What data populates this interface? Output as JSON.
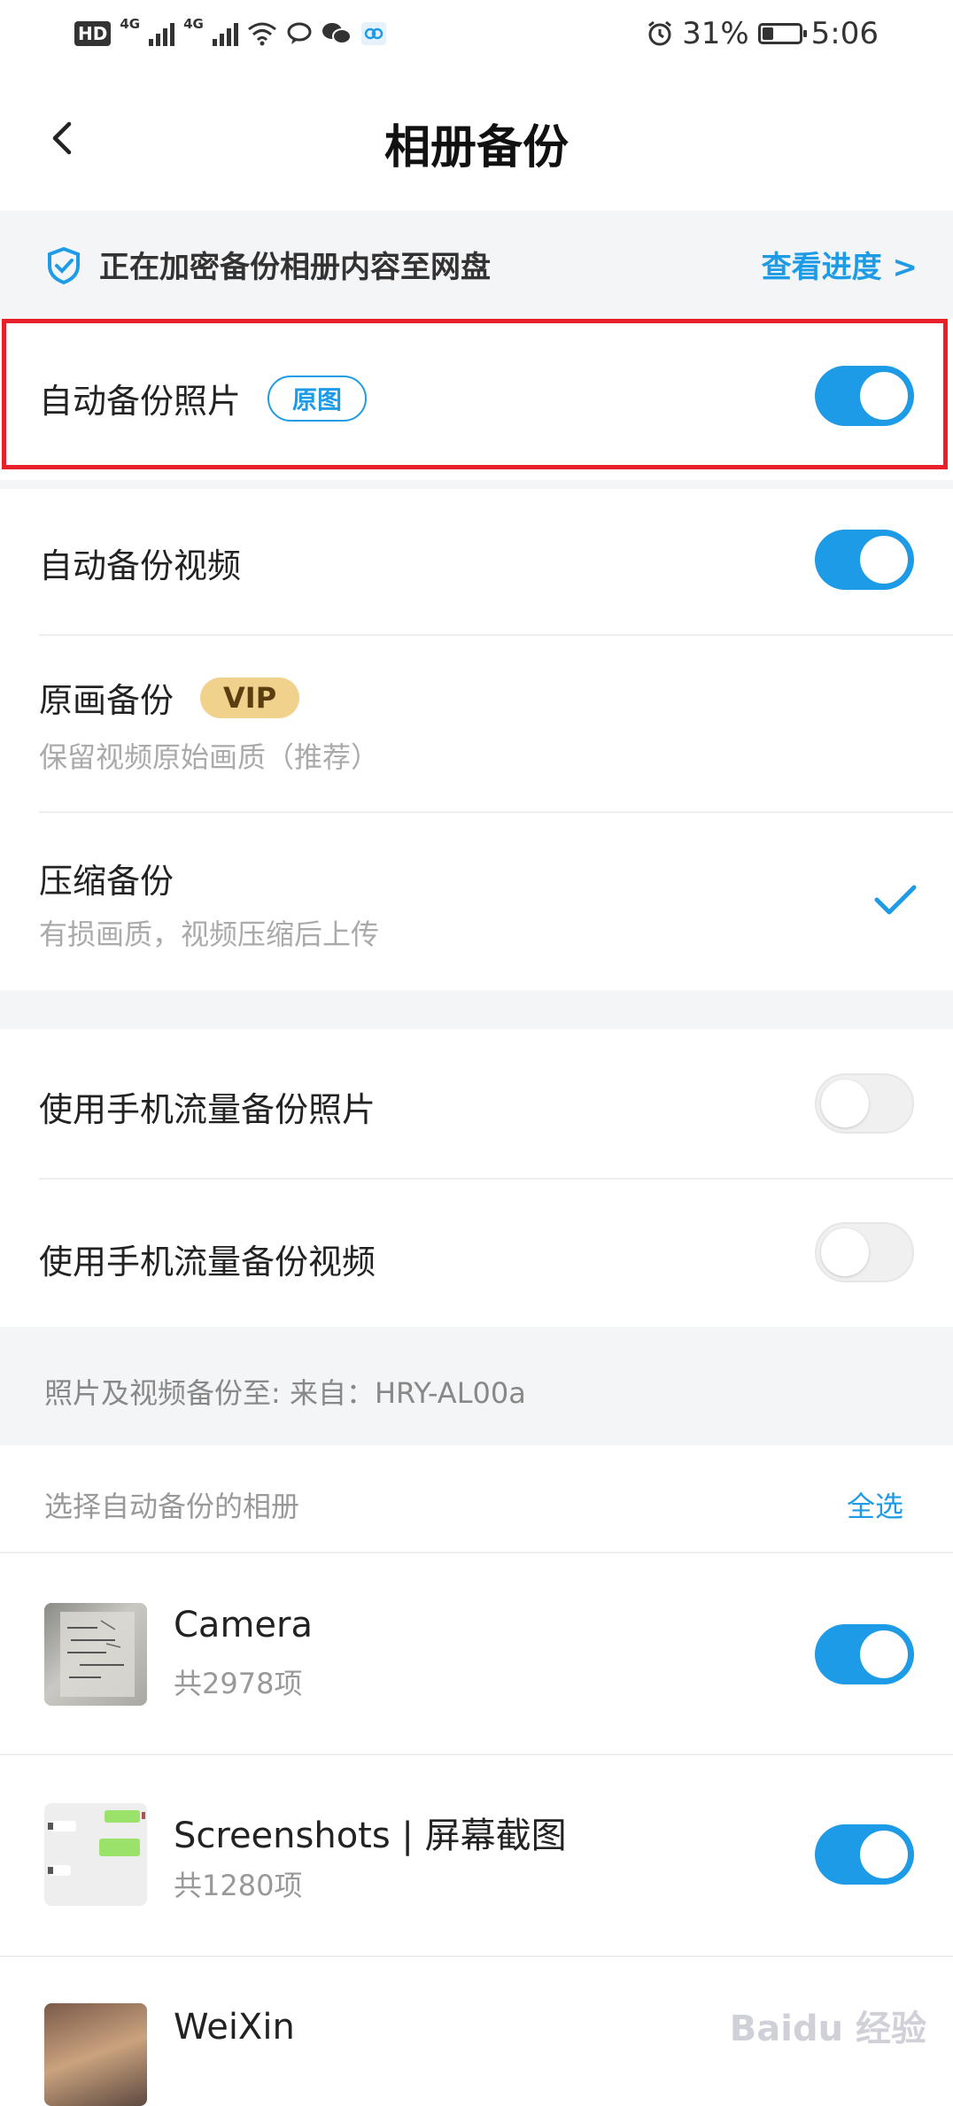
{
  "status": {
    "network_hd": "HD",
    "net1": "4G",
    "net2": "4G",
    "battery_pct": "31%",
    "battery_level": 0.31,
    "time": "5:06"
  },
  "nav": {
    "title": "相册备份"
  },
  "banner": {
    "message": "正在加密备份相册内容至网盘",
    "link": "查看进度 >"
  },
  "auto_photo": {
    "label": "自动备份照片",
    "tag": "原图",
    "enabled": true
  },
  "auto_video": {
    "label": "自动备份视频",
    "enabled": true
  },
  "original": {
    "label": "原画备份",
    "tag": "VIP",
    "desc": "保留视频原始画质（推荐）"
  },
  "compressed": {
    "label": "压缩备份",
    "desc": "有损画质，视频压缩后上传",
    "selected": true
  },
  "mobile_photo": {
    "label": "使用手机流量备份照片",
    "enabled": false
  },
  "mobile_video": {
    "label": "使用手机流量备份视频",
    "enabled": false
  },
  "dest": {
    "text": "照片及视频备份至: 来自：HRY-AL00a"
  },
  "albums_header": {
    "label": "选择自动备份的相册",
    "select_all": "全选"
  },
  "albums": [
    {
      "name": "Camera",
      "count": "共2978项",
      "enabled": true
    },
    {
      "name": "Screenshots | 屏幕截图",
      "count": "共1280项",
      "enabled": true
    },
    {
      "name": "WeiXin",
      "count": "",
      "enabled": true
    }
  ],
  "colors": {
    "accent": "#1e9be6",
    "highlight": "#e8202a",
    "vip": "#f0d28c"
  }
}
